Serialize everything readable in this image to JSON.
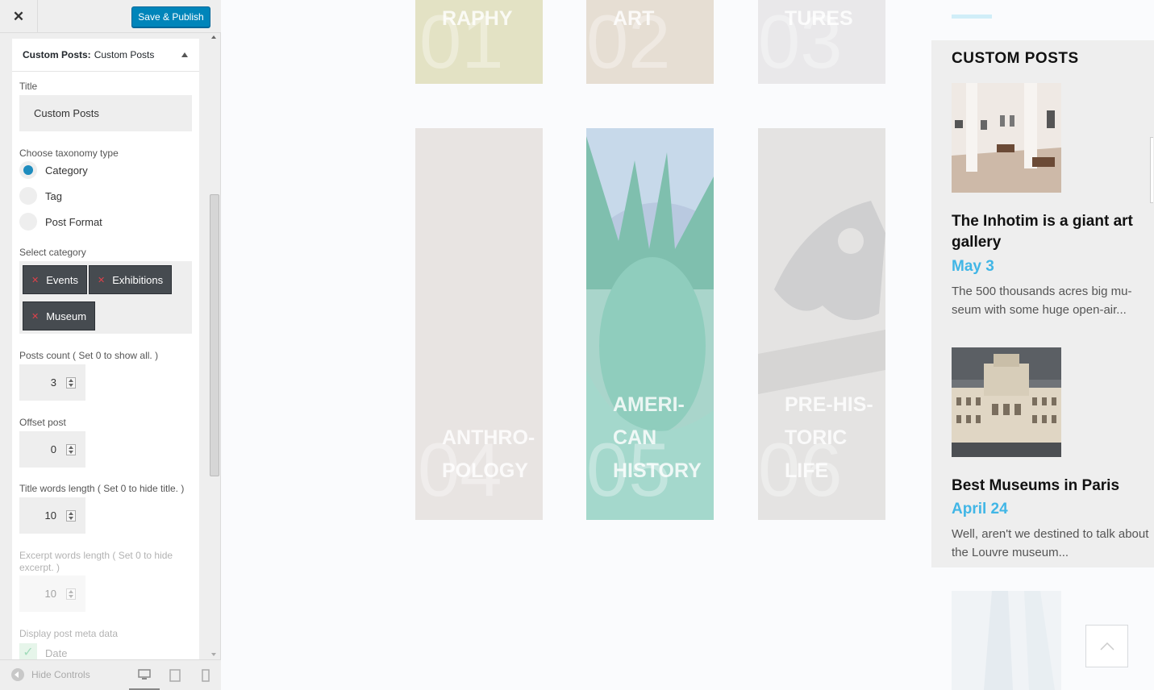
{
  "customizer": {
    "close_label": "✕",
    "save_label": "Save & Publish",
    "widget_heading_bold": "Custom Posts:",
    "widget_heading_name": "Custom Posts",
    "title_label": "Title",
    "title_value": "Custom Posts",
    "taxonomy_label": "Choose taxonomy type",
    "taxonomy_options": [
      "Category",
      "Tag",
      "Post Format"
    ],
    "taxonomy_selected": "Category",
    "category_label": "Select category",
    "categories": [
      "Events",
      "Exhibitions",
      "Museum"
    ],
    "posts_count_label": "Posts count ( Set 0 to show all. )",
    "posts_count_value": "3",
    "offset_label": "Offset post",
    "offset_value": "0",
    "title_words_label": "Title words length ( Set 0 to hide title. )",
    "title_words_value": "10",
    "excerpt_words_label": "Excerpt words length ( Set 0 to hide excerpt. )",
    "excerpt_words_value": "10",
    "meta_label": "Display post meta data",
    "meta_date_label": "Date",
    "hide_controls_label": "Hide Controls"
  },
  "preview": {
    "tiles": [
      {
        "num": "01",
        "label": "PHOTOG-\nRAPHY",
        "color": "#e3e2c4"
      },
      {
        "num": "02",
        "label": "MODERN\nART",
        "color": "#e6ded3"
      },
      {
        "num": "03",
        "label": "SCULP-\nTURES",
        "color": "#e9e8ea"
      },
      {
        "num": "04",
        "label": "ANTHRO-\nPOLOGY",
        "color": "#e8e4e2"
      },
      {
        "num": "05",
        "label": "AMERI-\nCAN\nHISTORY",
        "color": "#a9d5cb"
      },
      {
        "num": "06",
        "label": "PRE-HIS-\nTORIC\nLIFE",
        "color": "#e4e3e2"
      }
    ],
    "sidebar": {
      "title": "CUSTOM POSTS",
      "posts": [
        {
          "title": "The Inhotim is a giant art gallery",
          "date": "May 3",
          "excerpt": "The 500 thousands acres big mu-seum with some huge open-air..."
        },
        {
          "title": "Best Museums in Paris",
          "date": "April 24",
          "excerpt": "Well, aren't we destined to talk about the Louvre museum..."
        }
      ]
    }
  }
}
